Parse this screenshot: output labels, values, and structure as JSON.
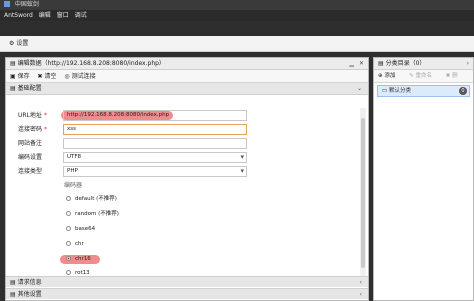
{
  "window": {
    "title": "中国蚁剑"
  },
  "menu": {
    "items": [
      "AntSword",
      "编辑",
      "窗口",
      "调试"
    ]
  },
  "tab": {
    "label": "设置"
  },
  "edit_panel": {
    "title": "编辑数据（http://192.168.8.208:8080/index.php）",
    "toolbar": {
      "save": "保存",
      "clear": "清空",
      "test": "测试连接"
    },
    "section_basic": "基础配置",
    "fields": {
      "url": {
        "label": "URL地址",
        "required": "*",
        "value": "http://192.168.8.208:8080/index.php"
      },
      "password": {
        "label": "连接密码",
        "required": "*",
        "value": "xss"
      },
      "remark": {
        "label": "网站备注",
        "value": ""
      },
      "encoding": {
        "label": "编码设置",
        "value": "UTF8"
      },
      "type": {
        "label": "连接类型",
        "value": "PHP"
      }
    },
    "encoder": {
      "label": "编码器",
      "options": [
        "default (不推荐)",
        "random (不推荐)",
        "base64",
        "chr",
        "chr16",
        "rot13"
      ],
      "selected": "chr16"
    },
    "section_request": "请求信息",
    "section_other": "其他设置"
  },
  "category_panel": {
    "title": "分类目录（0）",
    "tools": {
      "add": "添加",
      "rename": "重命名",
      "delete": "删除"
    },
    "items": [
      {
        "label": "默认分类",
        "count": "0"
      }
    ]
  },
  "colors": {
    "highlight": "#e65050",
    "focus_border": "#e8a05a",
    "selected_item": "#dcebfb"
  }
}
